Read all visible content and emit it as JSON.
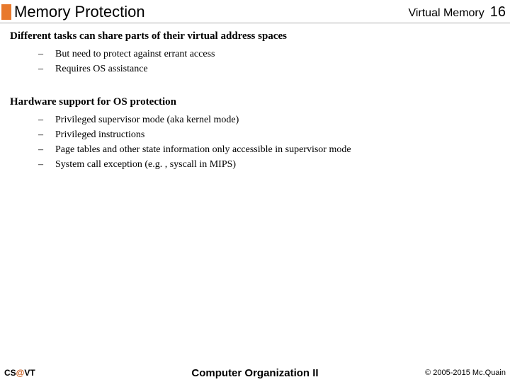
{
  "header": {
    "title": "Memory Protection",
    "subject": "Virtual Memory",
    "page_number": "16"
  },
  "sections": [
    {
      "heading": "Different tasks can share parts of their virtual address spaces",
      "bullets": [
        "But need to protect against errant access",
        "Requires OS assistance"
      ]
    },
    {
      "heading": "Hardware support for OS protection",
      "bullets": [
        "Privileged supervisor mode (aka kernel mode)",
        "Privileged instructions",
        "Page tables and other state information only accessible in supervisor mode",
        "System call exception (e.g. , syscall in MIPS)"
      ]
    }
  ],
  "footer": {
    "cs": "CS",
    "at": "@",
    "vt": "VT",
    "center": "Computer Organization II",
    "copyright": "© 2005-2015 Mc.Quain"
  }
}
